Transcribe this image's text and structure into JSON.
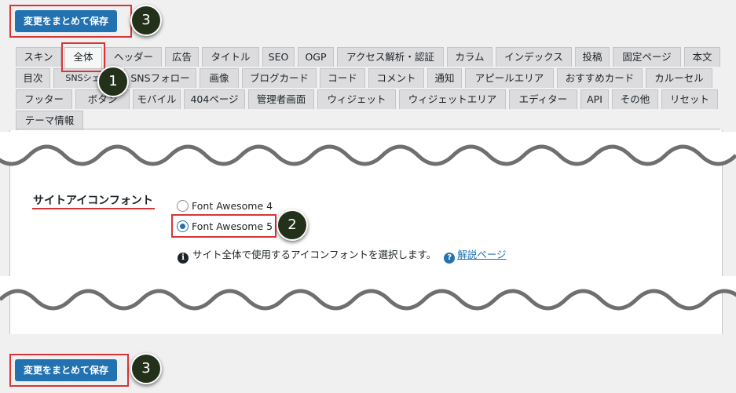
{
  "toolbar": {
    "save_label": "変更をまとめて保存"
  },
  "badges": {
    "one": "1",
    "two": "2",
    "three": "3"
  },
  "tabs": {
    "row1": [
      "スキン",
      "全体",
      "ヘッダー",
      "広告",
      "タイトル",
      "SEO",
      "OGP",
      "アクセス解析・認証",
      "カラム",
      "インデックス",
      "投稿",
      "固定ページ",
      "本文"
    ],
    "row2": [
      "目次",
      "SNSシェア",
      "SNSフォロー",
      "画像",
      "ブログカード",
      "コード",
      "コメント",
      "通知",
      "アピールエリア",
      "おすすめカード",
      "カルーセル"
    ],
    "row3": [
      "フッター",
      "ボタン",
      "モバイル",
      "404ページ",
      "管理者画面",
      "ウィジェット",
      "ウィジェットエリア",
      "エディター",
      "API",
      "その他",
      "リセット"
    ],
    "row4": [
      "テーマ情報"
    ],
    "active": "全体"
  },
  "setting": {
    "label": "サイトアイコンフォント",
    "options": [
      "Font Awesome 4",
      "Font Awesome 5"
    ],
    "selected": "Font Awesome 5",
    "description": "サイト全体で使用するアイコンフォントを選択します。",
    "help_link": "解説ページ",
    "info_glyph": "i",
    "help_glyph": "?"
  },
  "colors": {
    "accent": "#2271b1",
    "highlight": "#d63638",
    "badge": "#24311a"
  }
}
